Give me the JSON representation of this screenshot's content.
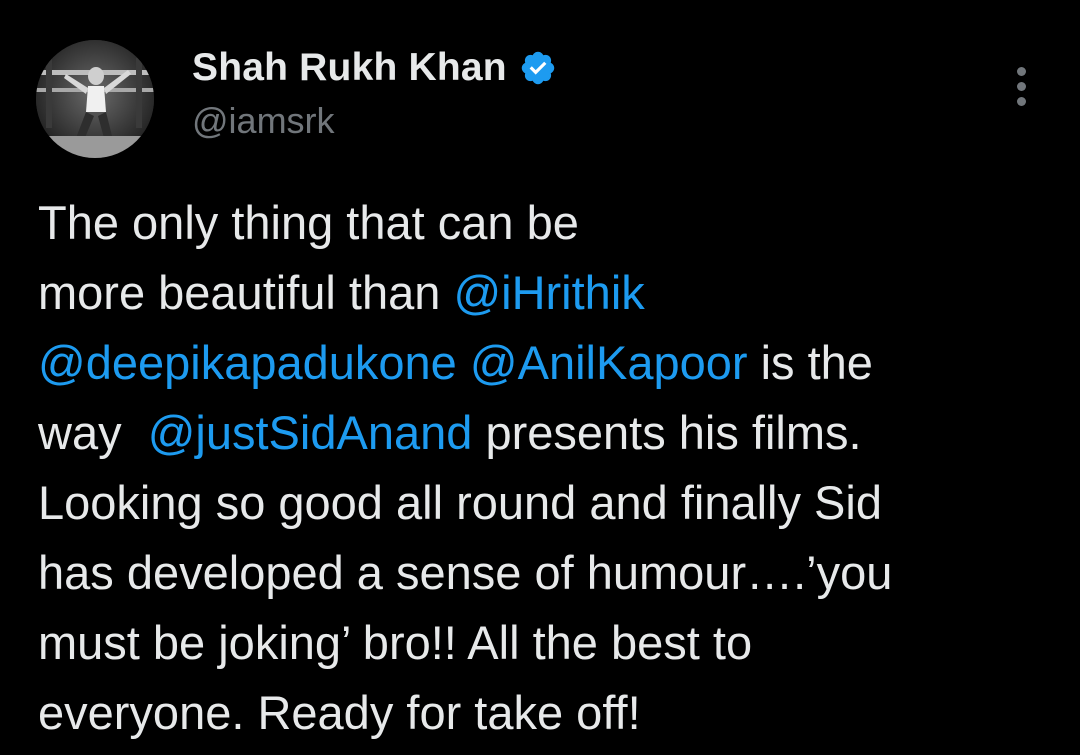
{
  "author": {
    "display_name": "Shah Rukh Khan",
    "handle": "@iamsrk",
    "verified": true,
    "avatar_icon": "profile-photo-bw"
  },
  "menu": {
    "icon": "more-vertical-icon"
  },
  "colors": {
    "background": "#000000",
    "text": "#E7E9EA",
    "secondary": "#71767B",
    "mention": "#1D9BF0",
    "verified": "#1D9BF0"
  },
  "tweet": {
    "lines": [
      [
        {
          "text": "The only thing that can be",
          "type": "text"
        }
      ],
      [
        {
          "text": "more beautiful than ",
          "type": "text"
        },
        {
          "text": "@iHrithik",
          "type": "mention"
        }
      ],
      [
        {
          "text": "@deepikapadukone",
          "type": "mention"
        },
        {
          "text": " ",
          "type": "text"
        },
        {
          "text": "@AnilKapoor",
          "type": "mention"
        },
        {
          "text": " is the",
          "type": "text"
        }
      ],
      [
        {
          "text": "way  ",
          "type": "text"
        },
        {
          "text": "@justSidAnand",
          "type": "mention"
        },
        {
          "text": " presents his films.",
          "type": "text"
        }
      ],
      [
        {
          "text": "Looking so good all round and finally Sid",
          "type": "text"
        }
      ],
      [
        {
          "text": "has developed a sense of humour….’you",
          "type": "text"
        }
      ],
      [
        {
          "text": "must be joking’ bro!! All the best to",
          "type": "text"
        }
      ],
      [
        {
          "text": "everyone. Ready for take off!",
          "type": "text"
        }
      ]
    ]
  }
}
